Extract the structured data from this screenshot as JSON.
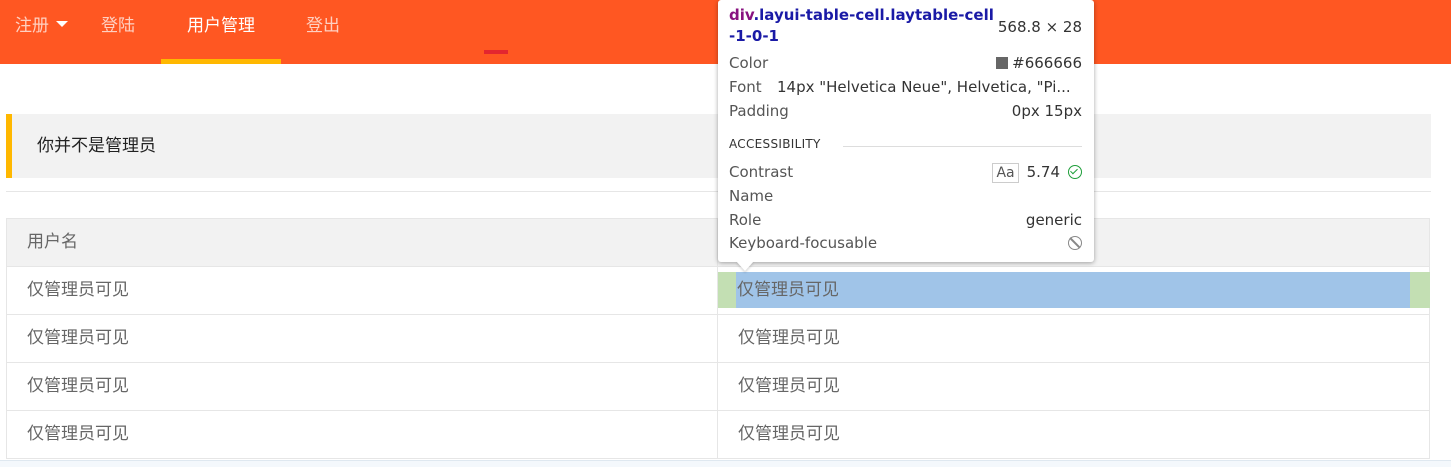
{
  "nav": {
    "items": [
      {
        "label": "注册"
      },
      {
        "label": "登陆"
      },
      {
        "label": "用户管理"
      },
      {
        "label": "登出"
      }
    ]
  },
  "notice": {
    "text": "你并不是管理员"
  },
  "table": {
    "headers": [
      "用户名",
      ""
    ],
    "rows": [
      [
        "仅管理员可见",
        "仅管理员可见"
      ],
      [
        "仅管理员可见",
        "仅管理员可见"
      ],
      [
        "仅管理员可见",
        "仅管理员可见"
      ],
      [
        "仅管理员可见",
        "仅管理员可见"
      ]
    ]
  },
  "devtools_tooltip": {
    "tag": "div",
    "classes": ".layui-table-cell.laytable-cell-1-0-1",
    "size": "568.8 × 28",
    "color_label": "Color",
    "color_value": "#666666",
    "font_label": "Font",
    "font_value": "14px \"Helvetica Neue\", Helvetica, \"Pi...",
    "padding_label": "Padding",
    "padding_value": "0px 15px",
    "section_title": "ACCESSIBILITY",
    "contrast_label": "Contrast",
    "contrast_aa": "Aa",
    "contrast_value": "5.74",
    "name_label": "Name",
    "role_label": "Role",
    "role_value": "generic",
    "keyboard_label": "Keyboard-focusable"
  },
  "colors": {
    "nav_bg": "#ff5722",
    "nav_active_underline": "#ffb800",
    "notice_accent": "#ffb800",
    "text_cell": "#666666"
  }
}
